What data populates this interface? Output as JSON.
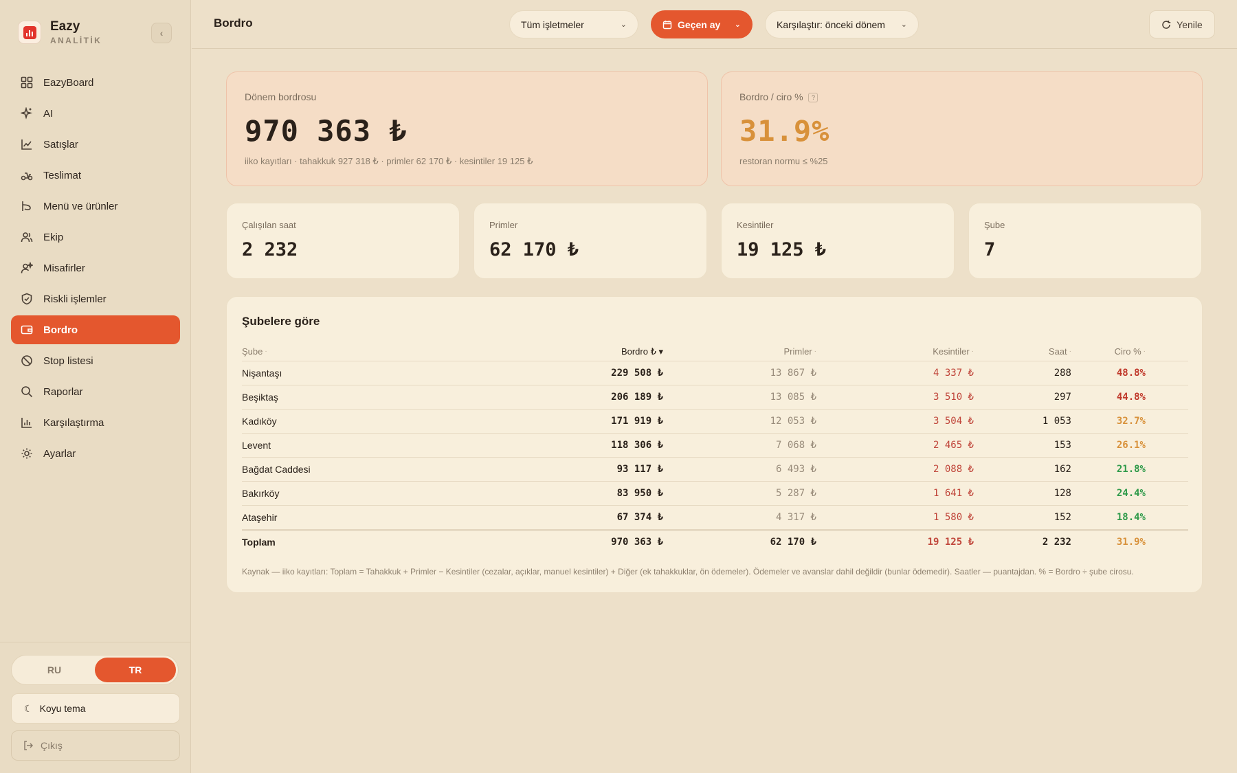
{
  "brand": {
    "name": "Eazy",
    "sub": "ANALİTİK"
  },
  "nav": [
    {
      "label": "EazyBoard",
      "icon": "grid-icon",
      "active": false
    },
    {
      "label": "AI",
      "icon": "sparkle-icon",
      "active": false
    },
    {
      "label": "Satışlar",
      "icon": "line-chart-icon",
      "active": false
    },
    {
      "label": "Teslimat",
      "icon": "scooter-icon",
      "active": false
    },
    {
      "label": "Menü ve ürünler",
      "icon": "menu-icon",
      "active": false
    },
    {
      "label": "Ekip",
      "icon": "users-icon",
      "active": false
    },
    {
      "label": "Misafirler",
      "icon": "guest-icon",
      "active": false
    },
    {
      "label": "Riskli işlemler",
      "icon": "shield-icon",
      "active": false
    },
    {
      "label": "Bordro",
      "icon": "wallet-icon",
      "active": true
    },
    {
      "label": "Stop listesi",
      "icon": "ban-icon",
      "active": false
    },
    {
      "label": "Raporlar",
      "icon": "search-icon",
      "active": false
    },
    {
      "label": "Karşılaştırma",
      "icon": "bar-chart-icon",
      "active": false
    },
    {
      "label": "Ayarlar",
      "icon": "gear-icon",
      "active": false
    }
  ],
  "lang": {
    "ru": "RU",
    "tr": "TR",
    "active": "TR"
  },
  "theme_label": "Koyu tema",
  "logout_label": "Çıkış",
  "header": {
    "title": "Bordro",
    "business_filter": "Tüm işletmeler",
    "period_filter": "Geçen ay",
    "compare_filter": "Karşılaştır: önceki dönem",
    "refresh_label": "Yenile"
  },
  "summary": {
    "period_payroll": {
      "label": "Dönem bordrosu",
      "value": "970 363 ₺",
      "sub": "iiko kayıtları · tahakkuk 927 318 ₺ · primler 62 170 ₺ · kesintiler 19 125 ₺"
    },
    "payroll_ratio": {
      "label": "Bordro / ciro %",
      "help": "?",
      "value": "31.9%",
      "sub": "restoran normu ≤ %25"
    }
  },
  "stats": [
    {
      "label": "Çalışılan saat",
      "value": "2 232"
    },
    {
      "label": "Primler",
      "value": "62 170 ₺"
    },
    {
      "label": "Kesintiler",
      "value": "19 125 ₺"
    },
    {
      "label": "Şube",
      "value": "7"
    }
  ],
  "table": {
    "title": "Şubelere göre",
    "headers": {
      "branch": "Şube",
      "payroll": "Bordro ₺ ▾",
      "bonus": "Primler",
      "deductions": "Kesintiler",
      "hours": "Saat",
      "ratio": "Ciro %"
    },
    "rows": [
      {
        "branch": "Nişantaşı",
        "payroll": "229 508 ₺",
        "bonus": "13 867 ₺",
        "deductions": "4 337 ₺",
        "hours": "288",
        "ratio": "48.8%",
        "ratio_color": "#c0392b"
      },
      {
        "branch": "Beşiktaş",
        "payroll": "206 189 ₺",
        "bonus": "13 085 ₺",
        "deductions": "3 510 ₺",
        "hours": "297",
        "ratio": "44.8%",
        "ratio_color": "#c0392b"
      },
      {
        "branch": "Kadıköy",
        "payroll": "171 919 ₺",
        "bonus": "12 053 ₺",
        "deductions": "3 504 ₺",
        "hours": "1 053",
        "ratio": "32.7%",
        "ratio_color": "#d8913a"
      },
      {
        "branch": "Levent",
        "payroll": "118 306 ₺",
        "bonus": "7 068 ₺",
        "deductions": "2 465 ₺",
        "hours": "153",
        "ratio": "26.1%",
        "ratio_color": "#d8913a"
      },
      {
        "branch": "Bağdat Caddesi",
        "payroll": "93 117 ₺",
        "bonus": "6 493 ₺",
        "deductions": "2 088 ₺",
        "hours": "162",
        "ratio": "21.8%",
        "ratio_color": "#2f9a4a"
      },
      {
        "branch": "Bakırköy",
        "payroll": "83 950 ₺",
        "bonus": "5 287 ₺",
        "deductions": "1 641 ₺",
        "hours": "128",
        "ratio": "24.4%",
        "ratio_color": "#2f9a4a"
      },
      {
        "branch": "Ataşehir",
        "payroll": "67 374 ₺",
        "bonus": "4 317 ₺",
        "deductions": "1 580 ₺",
        "hours": "152",
        "ratio": "18.4%",
        "ratio_color": "#2f9a4a"
      }
    ],
    "total": {
      "branch": "Toplam",
      "payroll": "970 363 ₺",
      "bonus": "62 170 ₺",
      "deductions": "19 125 ₺",
      "hours": "2 232",
      "ratio": "31.9%",
      "ratio_color": "#d8913a"
    },
    "footnote": "Kaynak — iiko kayıtları: Toplam = Tahakkuk + Primler − Kesintiler (cezalar, açıklar, manuel kesintiler) + Diğer (ek tahakkuklar, ön ödemeler). Ödemeler ve avanslar dahil değildir (bunlar ödemedir). Saatler — puantajdan. % = Bordro ÷ şube cirosu."
  },
  "colors": {
    "accent": "#e4572e",
    "warn": "#d8913a",
    "bad": "#c0392b",
    "good": "#2f9a4a"
  }
}
